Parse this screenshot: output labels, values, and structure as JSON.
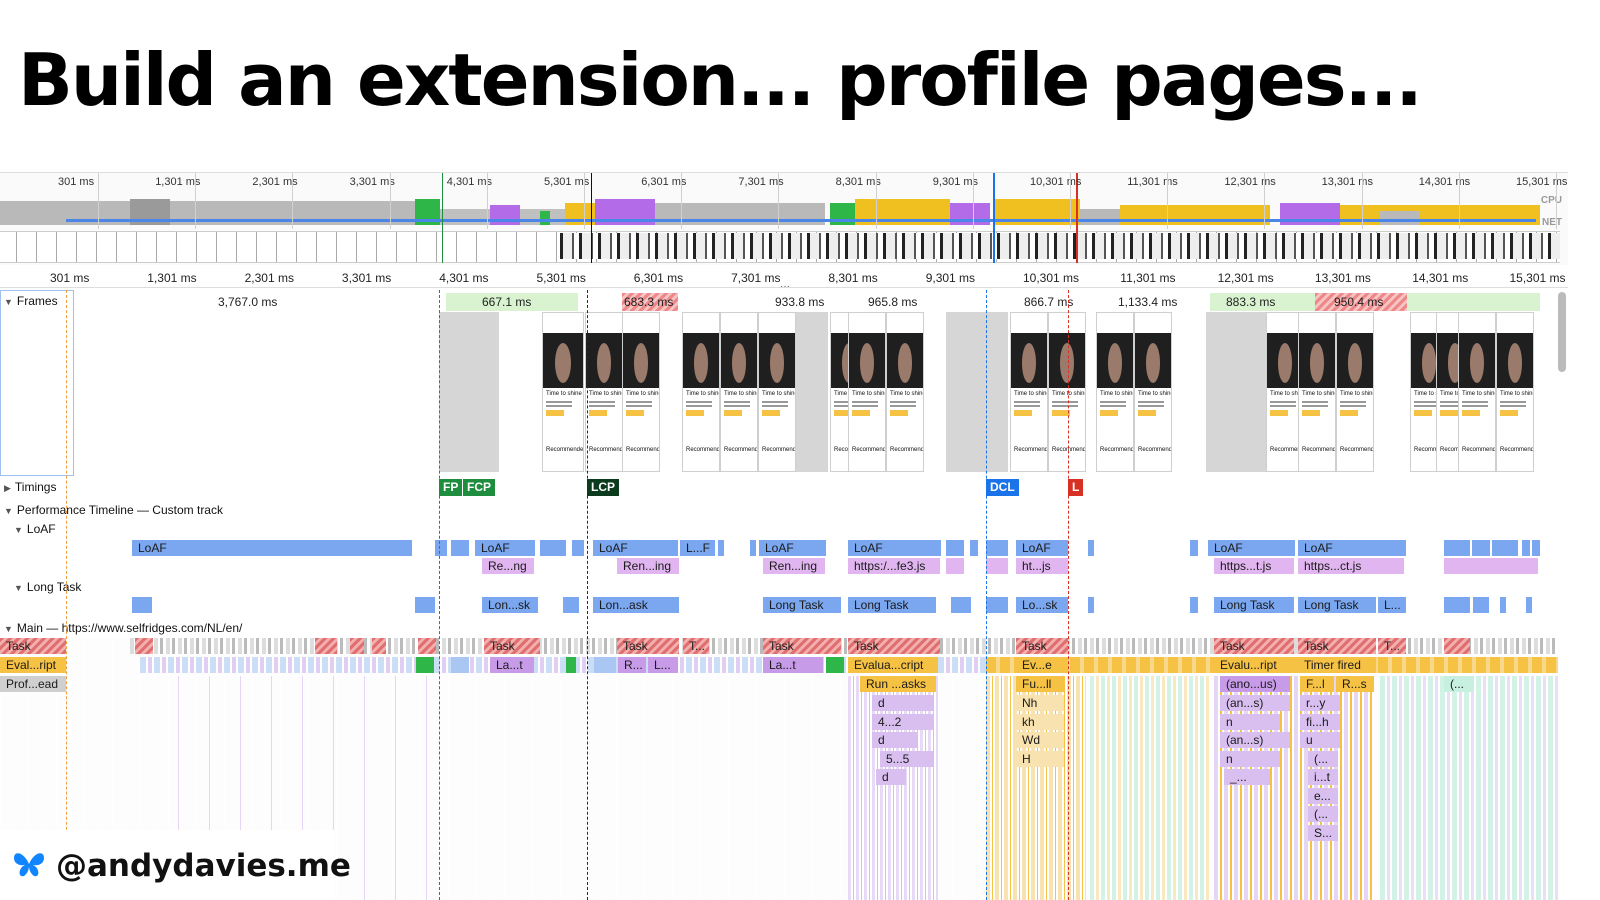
{
  "slide_title": "Build an extension... profile pages...",
  "overview": {
    "tick_labels": [
      "301 ms",
      "1,301 ms",
      "2,301 ms",
      "3,301 ms",
      "4,301 ms",
      "5,301 ms",
      "6,301 ms",
      "7,301 ms",
      "8,301 ms",
      "9,301 ms",
      "10,301 ms",
      "11,301 ms",
      "12,301 ms",
      "13,301 ms",
      "14,301 ms",
      "15,301 ms"
    ],
    "cpu_label": "CPU",
    "net_label": "NET"
  },
  "ruler": {
    "tick_labels": [
      "301 ms",
      "1,301 ms",
      "2,301 ms",
      "3,301 ms",
      "4,301 ms",
      "5,301 ms",
      "6,301 ms",
      "7,301 ms",
      "8,301 ms",
      "9,301 ms",
      "10,301 ms",
      "11,301 ms",
      "12,301 ms",
      "13,301 ms",
      "14,301 ms",
      "15,301 ms"
    ]
  },
  "tracks": {
    "frames": "Frames",
    "timings": "Timings",
    "custom": "Performance Timeline — Custom track",
    "loaf": "LoAF",
    "long_task": "Long Task",
    "main": "Main — https://www.selfridges.com/NL/en/"
  },
  "frame_durations": [
    "3,767.0 ms",
    "667.1 ms",
    "683.3 ms",
    "933.8 ms",
    "965.8 ms",
    "866.7 ms",
    "1,133.4 ms",
    "883.3 ms",
    "950.4 ms"
  ],
  "thumbnail": {
    "caption": "Time to shine",
    "recommended": "Recommended for you"
  },
  "timing_markers": [
    "FP",
    "FCP",
    "LCP",
    "DCL",
    "L"
  ],
  "marker_colors": {
    "FP": "#1e8e3e",
    "FCP": "#1e8e3e",
    "LCP": "#0d3b1e",
    "DCL": "#1a73e8",
    "L": "#d93025"
  },
  "loaf_labels": [
    "LoAF",
    "LoAF",
    "LoAF",
    "L...F",
    "LoAF",
    "LoAF",
    "LoAF",
    "LoAF",
    "LoAF"
  ],
  "loaf_sub_labels": [
    "Re...ng",
    "Ren...ing",
    "Ren...ing",
    "https:/...fe3.js",
    "ht...js",
    "https...t.js",
    "https...ct.js"
  ],
  "long_task_labels": [
    "Lon...sk",
    "Lon...ask",
    "Long Task",
    "Long Task",
    "Lo...sk",
    "Long Task",
    "Long Task",
    "L..."
  ],
  "main_row1": [
    "Task",
    "Task",
    "Task",
    "T...",
    "Task",
    "Task",
    "Task",
    "Task",
    "Task",
    "T..."
  ],
  "main_row2": [
    "Eval...ript",
    "La...t",
    "R...",
    "L...",
    "La...t",
    "Evalua...cript",
    "Ev...e",
    "Evalu...ript",
    "Timer fired"
  ],
  "main_row3": [
    "Prof...ead",
    "Run ...asks",
    "Fu...ll",
    "(ano...us)",
    "F...l",
    "R...s",
    "(..."
  ],
  "flame_col1": [
    "d",
    "4...2",
    "d",
    "5...5",
    "d"
  ],
  "flame_col2": [
    "Nh",
    "kh",
    "Wd",
    "H"
  ],
  "flame_col3": [
    "(an...s)",
    "n",
    "(an...s)",
    "n",
    "_..."
  ],
  "flame_col4": [
    "r...y",
    "fi...h",
    "u",
    "(...",
    "i...t",
    "e...",
    "(...",
    "S..."
  ],
  "footer": {
    "handle": "@andydavies.me",
    "icon": "butterfly-icon"
  }
}
